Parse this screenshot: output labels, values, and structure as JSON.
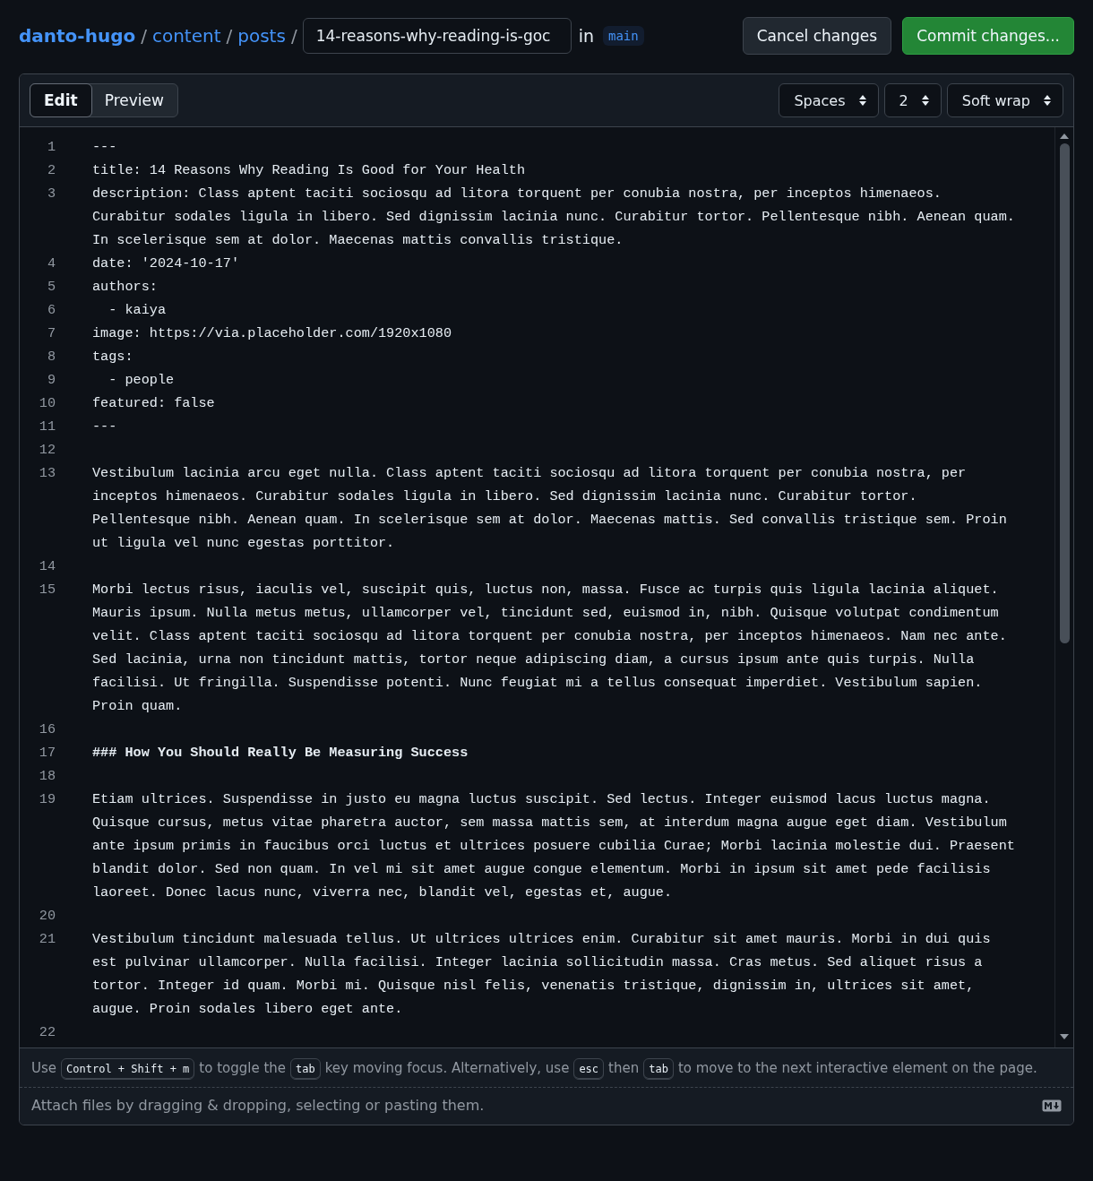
{
  "breadcrumb": {
    "repo": "danto-hugo",
    "folders": [
      "content",
      "posts"
    ],
    "separator": "/",
    "filename": "14-reasons-why-reading-is-goc",
    "in_label": "in",
    "branch": "main"
  },
  "actions": [
    {
      "label": "Cancel changes",
      "kind": "secondary"
    },
    {
      "label": "Commit changes...",
      "kind": "primary"
    }
  ],
  "tabs": [
    {
      "label": "Edit",
      "selected": true
    },
    {
      "label": "Preview",
      "selected": false
    }
  ],
  "selects": [
    {
      "label": "Spaces"
    },
    {
      "label": "2"
    },
    {
      "label": "Soft wrap"
    }
  ],
  "lines": [
    {
      "number": "1",
      "kind": "text",
      "rows": [
        "---"
      ]
    },
    {
      "number": "2",
      "kind": "text",
      "rows": [
        "title: 14 Reasons Why Reading Is Good for Your Health"
      ]
    },
    {
      "number": "3",
      "kind": "text",
      "rows": [
        "description: Class aptent taciti sociosqu ad litora torquent per conubia nostra, per inceptos himenaeos.",
        "Curabitur sodales ligula in libero. Sed dignissim lacinia nunc. Curabitur tortor. Pellentesque nibh. Aenean quam.",
        "In scelerisque sem at dolor. Maecenas mattis convallis tristique."
      ]
    },
    {
      "number": "4",
      "kind": "text",
      "rows": [
        "date: '2024-10-17'"
      ]
    },
    {
      "number": "5",
      "kind": "text",
      "rows": [
        "authors:"
      ]
    },
    {
      "number": "6",
      "kind": "text",
      "rows": [
        "  - kaiya"
      ]
    },
    {
      "number": "7",
      "kind": "text",
      "rows": [
        "image: https://via.placeholder.com/1920x1080"
      ]
    },
    {
      "number": "8",
      "kind": "text",
      "rows": [
        "tags:"
      ]
    },
    {
      "number": "9",
      "kind": "text",
      "rows": [
        "  - people"
      ]
    },
    {
      "number": "10",
      "kind": "text",
      "rows": [
        "featured: false"
      ]
    },
    {
      "number": "11",
      "kind": "text",
      "rows": [
        "---"
      ]
    },
    {
      "number": "12"
    },
    {
      "number": "13",
      "kind": "text",
      "rows": [
        "Vestibulum lacinia arcu eget nulla. Class aptent taciti sociosqu ad litora torquent per conubia nostra, per",
        "inceptos himenaeos. Curabitur sodales ligula in libero. Sed dignissim lacinia nunc. Curabitur tortor.",
        "Pellentesque nibh. Aenean quam. In scelerisque sem at dolor. Maecenas mattis. Sed convallis tristique sem. Proin",
        "ut ligula vel nunc egestas porttitor."
      ]
    },
    {
      "number": "14"
    },
    {
      "number": "15",
      "kind": "text",
      "rows": [
        "Morbi lectus risus, iaculis vel, suscipit quis, luctus non, massa. Fusce ac turpis quis ligula lacinia aliquet.",
        "Mauris ipsum. Nulla metus metus, ullamcorper vel, tincidunt sed, euismod in, nibh. Quisque volutpat condimentum",
        "velit. Class aptent taciti sociosqu ad litora torquent per conubia nostra, per inceptos himenaeos. Nam nec ante.",
        "Sed lacinia, urna non tincidunt mattis, tortor neque adipiscing diam, a cursus ipsum ante quis turpis. Nulla",
        "facilisi. Ut fringilla. Suspendisse potenti. Nunc feugiat mi a tellus consequat imperdiet. Vestibulum sapien.",
        "Proin quam."
      ]
    },
    {
      "number": "16"
    },
    {
      "number": "17",
      "kind": "heading",
      "rows": [
        "### How You Should Really Be Measuring Success"
      ]
    },
    {
      "number": "18"
    },
    {
      "number": "19",
      "kind": "text",
      "rows": [
        "Etiam ultrices. Suspendisse in justo eu magna luctus suscipit. Sed lectus. Integer euismod lacus luctus magna.",
        "Quisque cursus, metus vitae pharetra auctor, sem massa mattis sem, at interdum magna augue eget diam. Vestibulum",
        "ante ipsum primis in faucibus orci luctus et ultrices posuere cubilia Curae; Morbi lacinia molestie dui. Praesent",
        "blandit dolor. Sed non quam. In vel mi sit amet augue congue elementum. Morbi in ipsum sit amet pede facilisis",
        "laoreet. Donec lacus nunc, viverra nec, blandit vel, egestas et, augue."
      ]
    },
    {
      "number": "20"
    },
    {
      "number": "21",
      "kind": "text",
      "rows": [
        "Vestibulum tincidunt malesuada tellus. Ut ultrices ultrices enim. Curabitur sit amet mauris. Morbi in dui quis",
        "est pulvinar ullamcorper. Nulla facilisi. Integer lacinia sollicitudin massa. Cras metus. Sed aliquet risus a",
        "tortor. Integer id quam. Morbi mi. Quisque nisl felis, venenatis tristique, dignissim in, ultrices sit amet,",
        "augue. Proin sodales libero eget ante."
      ]
    },
    {
      "number": "22"
    }
  ],
  "hint": [
    {
      "kind": "text",
      "text": "Use"
    },
    {
      "kind": "key",
      "text": "Control + Shift + m"
    },
    {
      "kind": "text",
      "text": "to toggle the"
    },
    {
      "kind": "key",
      "text": "tab"
    },
    {
      "kind": "text",
      "text": "key moving focus. Alternatively, use"
    },
    {
      "kind": "key",
      "text": "esc"
    },
    {
      "kind": "text",
      "text": "then"
    },
    {
      "kind": "key",
      "text": "tab"
    },
    {
      "kind": "text",
      "text": "to move to the next interactive element on the"
    },
    {
      "kind": "text",
      "text": "page."
    }
  ],
  "attach": "Attach files by dragging & dropping, selecting or pasting them."
}
